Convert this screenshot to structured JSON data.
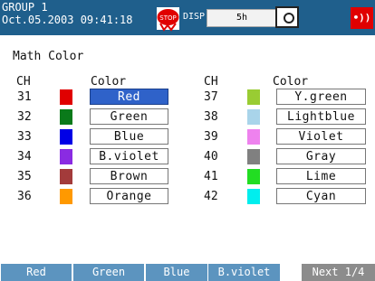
{
  "header": {
    "group": "GROUP 1",
    "datetime": "Oct.05.2003 09:41:18",
    "stop_icon_text": "STOP",
    "disp_label": "DISP",
    "time_div": "5h",
    "alarm_icon_text": "•))"
  },
  "page_title": "Math Color",
  "columns": {
    "ch": "CH",
    "color": "Color"
  },
  "left_rows": [
    {
      "ch": "31",
      "color": "Red",
      "hex": "#e00000",
      "selected": true
    },
    {
      "ch": "32",
      "color": "Green",
      "hex": "#0a7a1a"
    },
    {
      "ch": "33",
      "color": "Blue",
      "hex": "#0000e6"
    },
    {
      "ch": "34",
      "color": "B.violet",
      "hex": "#8a2be2"
    },
    {
      "ch": "35",
      "color": "Brown",
      "hex": "#a33b3b"
    },
    {
      "ch": "36",
      "color": "Orange",
      "hex": "#ff9900"
    }
  ],
  "right_rows": [
    {
      "ch": "37",
      "color": "Y.green",
      "hex": "#99cc33"
    },
    {
      "ch": "38",
      "color": "Lightblue",
      "hex": "#a9d4ea"
    },
    {
      "ch": "39",
      "color": "Violet",
      "hex": "#ee82ee"
    },
    {
      "ch": "40",
      "color": "Gray",
      "hex": "#808080"
    },
    {
      "ch": "41",
      "color": "Lime",
      "hex": "#22dd22"
    },
    {
      "ch": "42",
      "color": "Cyan",
      "hex": "#00eeee"
    }
  ],
  "softkeys": [
    "Red",
    "Green",
    "Blue",
    "B.violet",
    "Next 1/4"
  ]
}
